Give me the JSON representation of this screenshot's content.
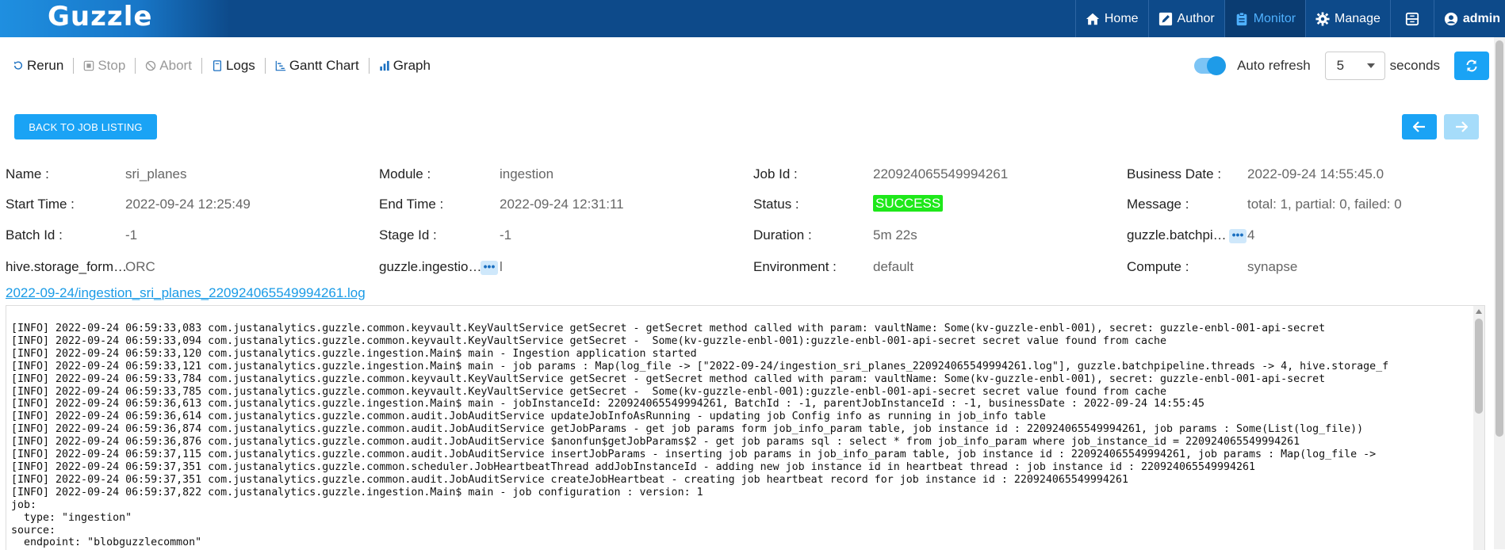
{
  "brand": {
    "name": "Guzzle"
  },
  "nav": {
    "home": "Home",
    "author": "Author",
    "monitor": "Monitor",
    "manage": "Manage",
    "user": "admin"
  },
  "toolbar": {
    "rerun": "Rerun",
    "stop": "Stop",
    "abort": "Abort",
    "logs": "Logs",
    "gantt": "Gantt Chart",
    "graph": "Graph",
    "auto_refresh": "Auto refresh",
    "refresh_value": "5",
    "seconds": "seconds",
    "auto_refresh_on": true
  },
  "back_button": "BACK TO JOB LISTING",
  "details": {
    "name_label": "Name :",
    "name": "sri_planes",
    "module_label": "Module :",
    "module": "ingestion",
    "jobid_label": "Job Id :",
    "jobid": "220924065549994261",
    "bizdate_label": "Business Date :",
    "bizdate": "2022-09-24 14:55:45.0",
    "start_label": "Start Time :",
    "start": "2022-09-24 12:25:49",
    "end_label": "End Time :",
    "end": "2022-09-24 12:31:11",
    "status_label": "Status :",
    "status": "SUCCESS",
    "message_label": "Message :",
    "message": "total: 1, partial: 0, failed: 0",
    "batch_label": "Batch Id :",
    "batch": "-1",
    "stage_label": "Stage Id :",
    "stage": "-1",
    "duration_label": "Duration :",
    "duration": "5m 22s",
    "threads_label": "guzzle.batchpi…",
    "threads": "4",
    "hive_label": "hive.storage_form…",
    "hive": "ORC",
    "ingestion_label": "guzzle.ingestio…",
    "ingestion": "l",
    "env_label": "Environment :",
    "env": "default",
    "compute_label": "Compute :",
    "compute": "synapse"
  },
  "log_link": "2022-09-24/ingestion_sri_planes_220924065549994261.log",
  "log_lines": [
    "[INFO] 2022-09-24 06:59:33,083 com.justanalytics.guzzle.common.keyvault.KeyVaultService getSecret - getSecret method called with param: vaultName: Some(kv-guzzle-enbl-001), secret: guzzle-enbl-001-api-secret",
    "[INFO] 2022-09-24 06:59:33,094 com.justanalytics.guzzle.common.keyvault.KeyVaultService getSecret -  Some(kv-guzzle-enbl-001):guzzle-enbl-001-api-secret secret value found from cache",
    "[INFO] 2022-09-24 06:59:33,120 com.justanalytics.guzzle.ingestion.Main$ main - Ingestion application started",
    "[INFO] 2022-09-24 06:59:33,121 com.justanalytics.guzzle.ingestion.Main$ main - job params : Map(log_file -> [\"2022-09-24/ingestion_sri_planes_220924065549994261.log\"], guzzle.batchpipeline.threads -> 4, hive.storage_f",
    "[INFO] 2022-09-24 06:59:33,784 com.justanalytics.guzzle.common.keyvault.KeyVaultService getSecret - getSecret method called with param: vaultName: Some(kv-guzzle-enbl-001), secret: guzzle-enbl-001-api-secret",
    "[INFO] 2022-09-24 06:59:33,785 com.justanalytics.guzzle.common.keyvault.KeyVaultService getSecret -  Some(kv-guzzle-enbl-001):guzzle-enbl-001-api-secret secret value found from cache",
    "[INFO] 2022-09-24 06:59:36,613 com.justanalytics.guzzle.ingestion.Main$ main - jobInstanceId: 220924065549994261, BatchId : -1, parentJobInstanceId : -1, businessDate : 2022-09-24 14:55:45",
    "[INFO] 2022-09-24 06:59:36,614 com.justanalytics.guzzle.common.audit.JobAuditService updateJobInfoAsRunning - updating job Config info as running in job_info table",
    "[INFO] 2022-09-24 06:59:36,874 com.justanalytics.guzzle.common.audit.JobAuditService getJobParams - get job params form job_info_param table, job instance id : 220924065549994261, job params : Some(List(log_file))",
    "[INFO] 2022-09-24 06:59:36,876 com.justanalytics.guzzle.common.audit.JobAuditService $anonfun$getJobParams$2 - get job params sql : select * from job_info_param where job_instance_id = 220924065549994261",
    "[INFO] 2022-09-24 06:59:37,115 com.justanalytics.guzzle.common.audit.JobAuditService insertJobParams - inserting job params in job_info_param table, job instance id : 220924065549994261, job params : Map(log_file ->",
    "[INFO] 2022-09-24 06:59:37,351 com.justanalytics.guzzle.common.scheduler.JobHeartbeatThread addJobInstanceId - adding new job instance id in heartbeat thread : job instance id : 220924065549994261",
    "[INFO] 2022-09-24 06:59:37,351 com.justanalytics.guzzle.common.audit.JobAuditService createJobHeartbeat - creating job heartbeat record for job instance id : 220924065549994261",
    "[INFO] 2022-09-24 06:59:37,822 com.justanalytics.guzzle.ingestion.Main$ main - job configuration : version: 1",
    "job:",
    "  type: \"ingestion\"",
    "source:",
    "  endpoint: \"blobguzzlecommon\""
  ]
}
